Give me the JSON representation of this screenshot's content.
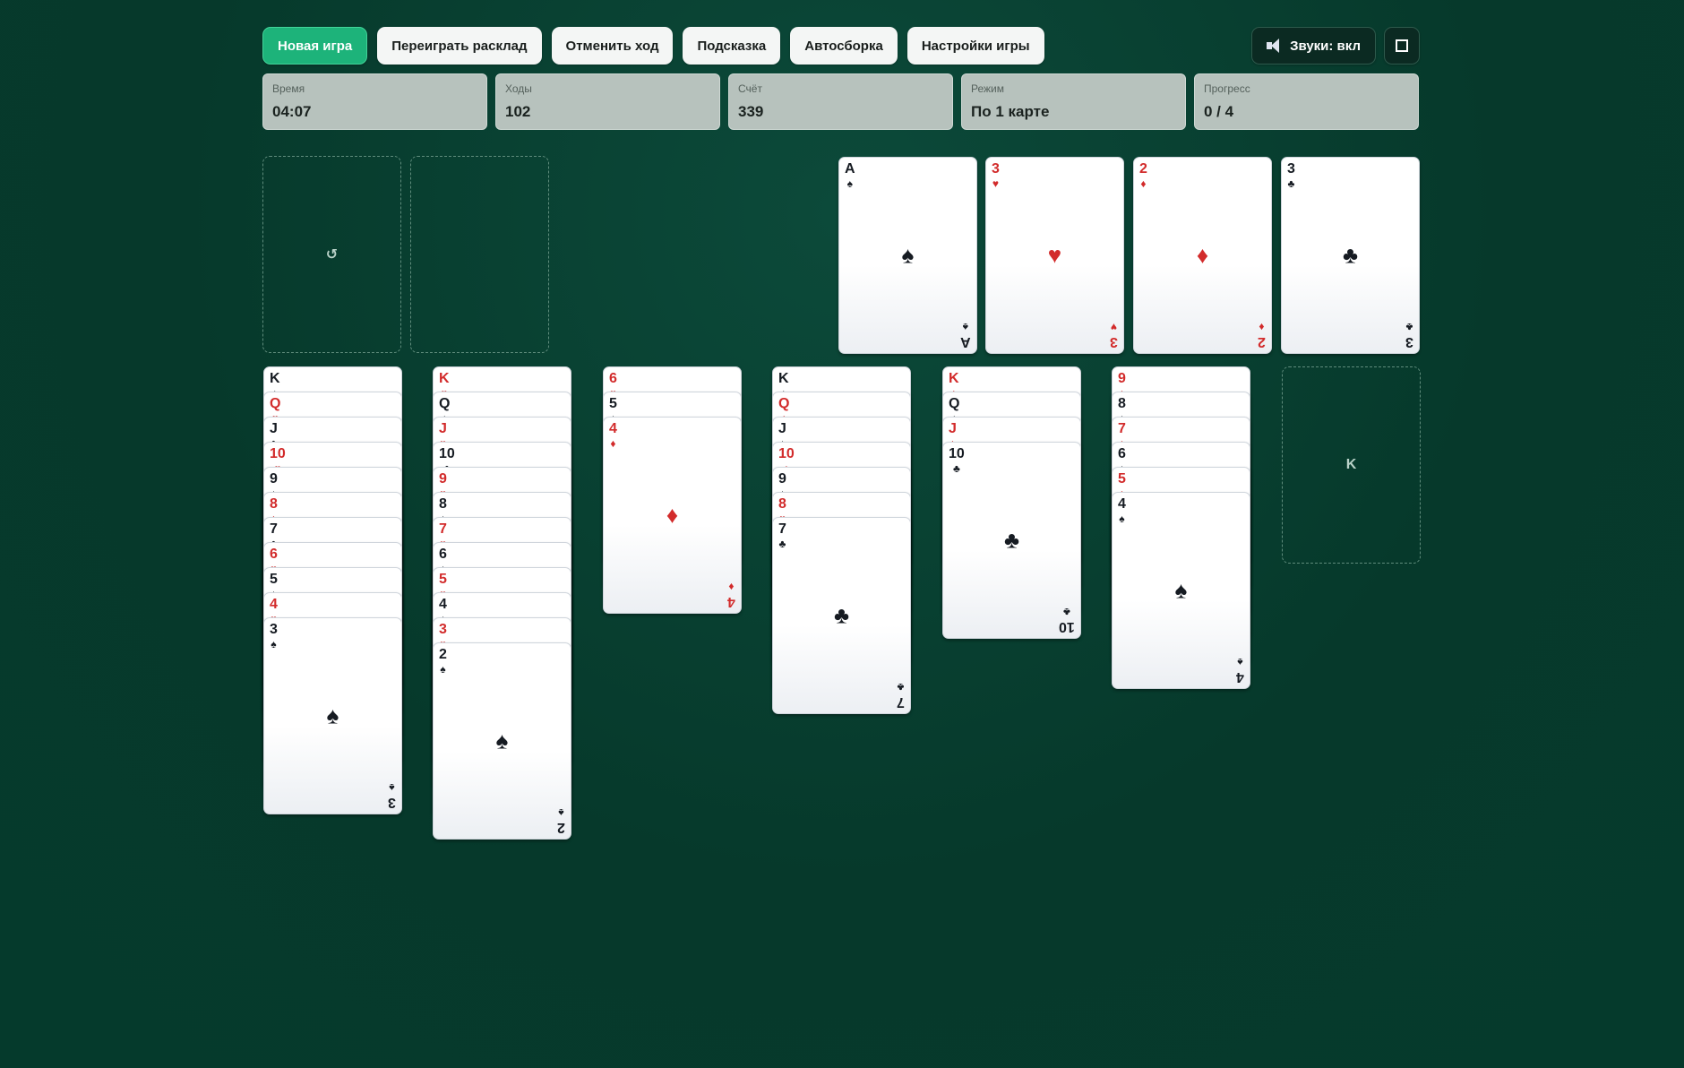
{
  "toolbar": {
    "new_game": "Новая игра",
    "replay": "Переиграть расклад",
    "undo": "Отменить ход",
    "hint": "Подсказка",
    "auto": "Автосборка",
    "settings": "Настройки игры",
    "sound": "Звуки: вкл"
  },
  "stats": {
    "time_label": "Время",
    "time_value": "04:07",
    "moves_label": "Ходы",
    "moves_value": "102",
    "score_label": "Счёт",
    "score_value": "339",
    "mode_label": "Режим",
    "mode_value": "По 1 карте",
    "progress_label": "Прогресс",
    "progress_value": "0 / 4"
  },
  "stock": {
    "symbol": "↺"
  },
  "empty_column_label": "K",
  "colors": {
    "red": "#d22b2b",
    "black": "#161b22",
    "accent": "#1db37a"
  },
  "foundations": [
    {
      "rank": "A",
      "suit": "♠"
    },
    {
      "rank": "3",
      "suit": "♥"
    },
    {
      "rank": "2",
      "suit": "♦"
    },
    {
      "rank": "3",
      "suit": "♣"
    }
  ],
  "tableau": [
    [
      "K♠",
      "Q♥",
      "J♣",
      "10♥",
      "9♠",
      "8♦",
      "7♣",
      "6♥",
      "5♠",
      "4♥",
      "3♠"
    ],
    [
      "K♥",
      "Q♠",
      "J♥",
      "10♣",
      "9♥",
      "8♠",
      "7♥",
      "6♠",
      "5♥",
      "4♠",
      "3♥",
      "2♠"
    ],
    [
      "6♥",
      "5♠",
      "4♦"
    ],
    [
      "K♠",
      "Q♦",
      "J♠",
      "10♦",
      "9♠",
      "8♥",
      "7♣"
    ],
    [
      "K♦",
      "Q♠",
      "J♦",
      "10♣"
    ],
    [
      "9♦",
      "8♠",
      "7♦",
      "6♠",
      "5♦",
      "4♠"
    ],
    []
  ]
}
